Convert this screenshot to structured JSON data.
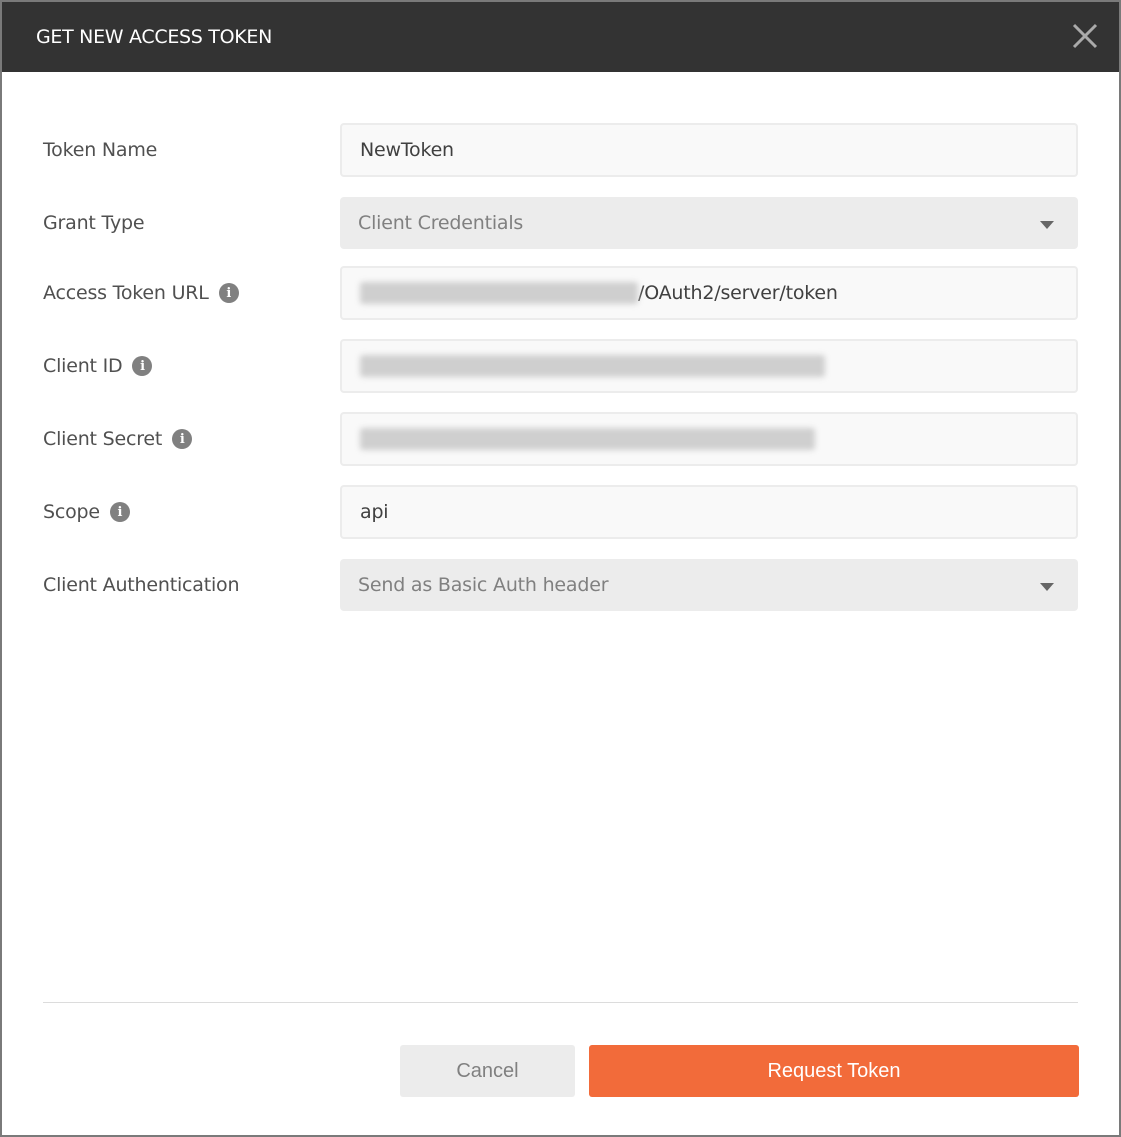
{
  "dialog": {
    "title": "GET NEW ACCESS TOKEN",
    "close_icon": "close-icon"
  },
  "form": {
    "token_name": {
      "label": "Token Name",
      "value": "NewToken"
    },
    "grant_type": {
      "label": "Grant Type",
      "value": "Client Credentials"
    },
    "access_token_url": {
      "label": "Access Token URL",
      "value_visible_suffix": "/OAuth2/server/token"
    },
    "client_id": {
      "label": "Client ID"
    },
    "client_secret": {
      "label": "Client Secret"
    },
    "scope": {
      "label": "Scope",
      "value": "api"
    },
    "client_authentication": {
      "label": "Client Authentication",
      "value": "Send as Basic Auth header"
    }
  },
  "footer": {
    "cancel_label": "Cancel",
    "request_label": "Request Token"
  },
  "colors": {
    "header": "#333333",
    "accent": "#f26b3a"
  }
}
